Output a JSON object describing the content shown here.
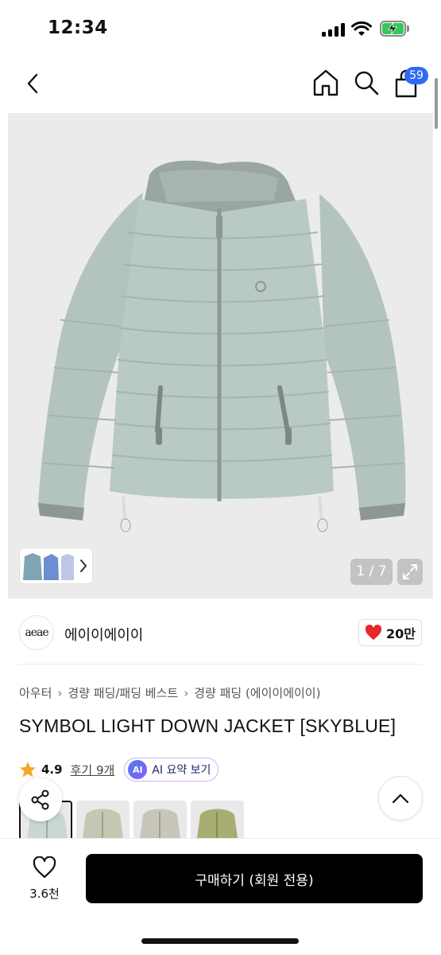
{
  "status_bar": {
    "time": "12:34"
  },
  "nav": {
    "cart_count": "59"
  },
  "gallery": {
    "counter": "1 / 7"
  },
  "brand": {
    "logo_text": "aeae",
    "name": "에이이에이이",
    "likes": "20만"
  },
  "breadcrumb": [
    "아우터",
    "경량 패딩/패딩 베스트",
    "경량 패딩 (에이이에이이)"
  ],
  "product": {
    "title": "SYMBOL LIGHT DOWN JACKET [SKYBLUE]",
    "rating": "4.9",
    "reviews": "후기 9개",
    "ai_badge": "AI",
    "ai_summary": "AI 요약 보기"
  },
  "swatches": [
    "#c9d6d4",
    "#c3c8b3",
    "#c8c6bb",
    "#a8ad72"
  ],
  "bottom": {
    "wish_count": "3.6천",
    "buy_label": "구매하기 (회원 전용)"
  },
  "colors": {
    "accent": "#2f6af5",
    "heart": "#e8262d",
    "star": "#f5a623",
    "jacket": "#b7c7c4"
  }
}
